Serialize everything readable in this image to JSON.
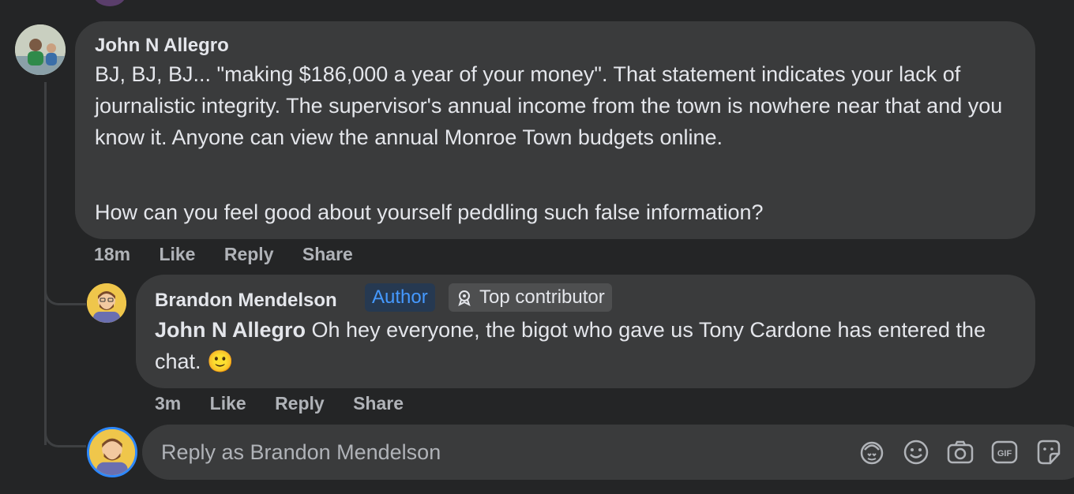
{
  "comment": {
    "author": "John N Allegro",
    "paragraphs": [
      "BJ, BJ, BJ... \"making $186,000 a year of your money\". That statement indicates your lack of journalistic integrity. The supervisor's annual income from the town is nowhere near that and you know it. Anyone can view the annual Monroe Town budgets online.",
      "How can you feel good about yourself peddling such false information?"
    ],
    "time": "18m",
    "like": "Like",
    "reply": "Reply",
    "share": "Share"
  },
  "reply": {
    "author": "Brandon Mendelson",
    "author_badge": "Author",
    "contributor_badge": "Top contributor",
    "mention": "John N Allegro",
    "text": " Oh hey everyone, the bigot who gave us Tony Cardone has entered the chat. 🙂",
    "time": "3m",
    "like": "Like",
    "reply": "Reply",
    "share": "Share"
  },
  "composer": {
    "placeholder": "Reply as Brandon Mendelson",
    "icons": [
      "avatar-sticker-icon",
      "emoji-icon",
      "camera-icon",
      "gif-icon",
      "sticker-icon"
    ]
  },
  "colors": {
    "background": "#242526",
    "bubble": "#3a3b3c",
    "author_badge_text": "#4599ff",
    "composer_ring": "#2d88ff"
  }
}
